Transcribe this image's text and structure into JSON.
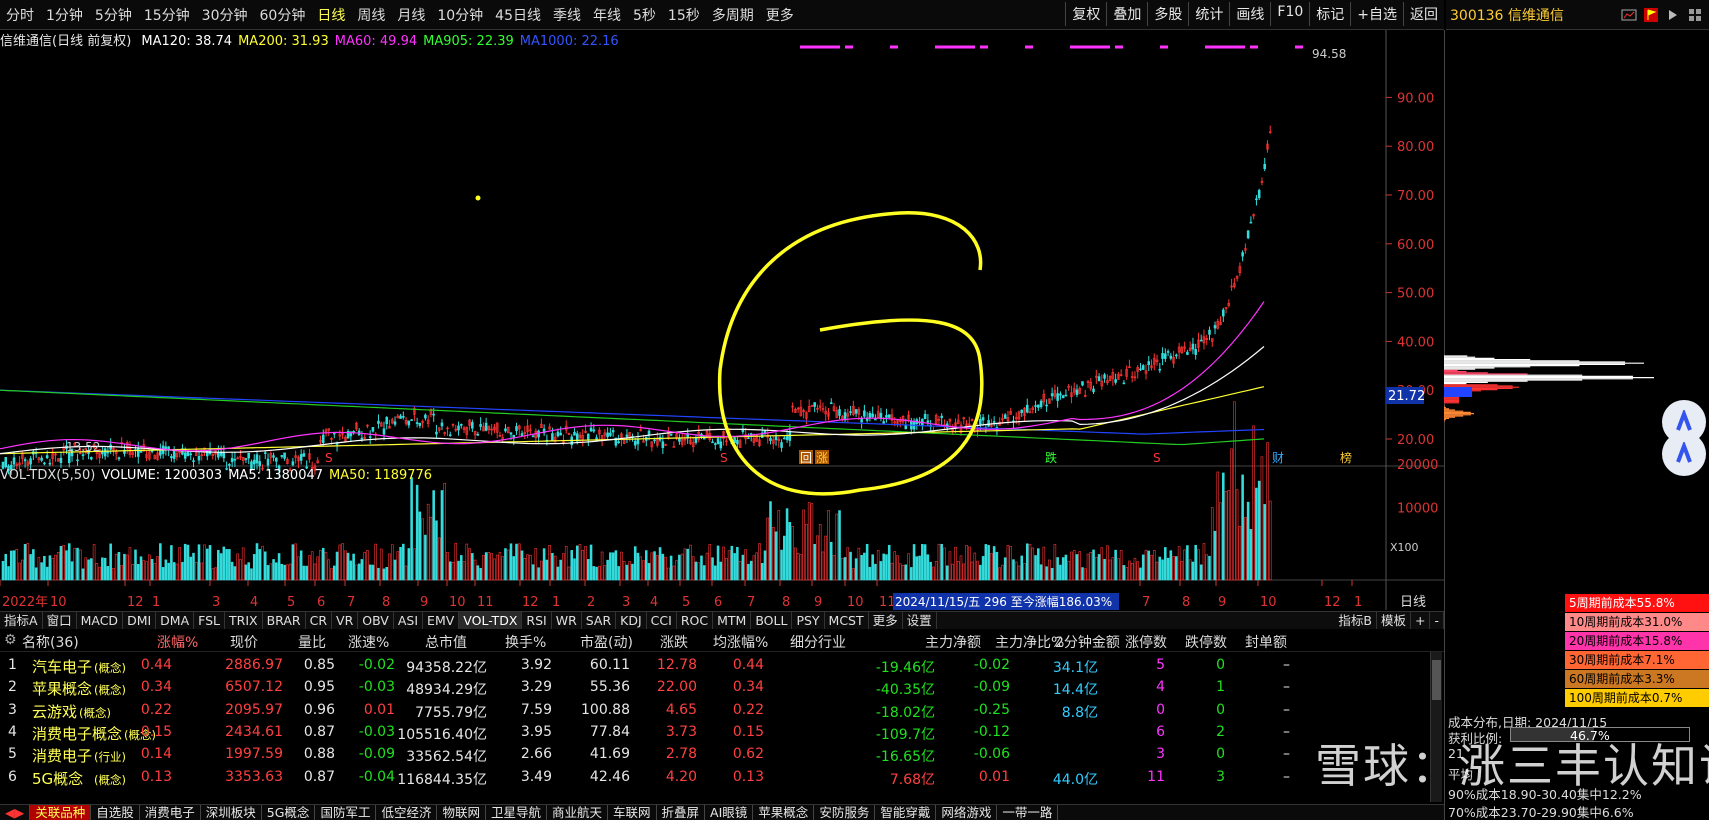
{
  "periods": [
    {
      "label": "分时",
      "active": false
    },
    {
      "label": "1分钟",
      "active": false
    },
    {
      "label": "5分钟",
      "active": false
    },
    {
      "label": "15分钟",
      "active": false
    },
    {
      "label": "30分钟",
      "active": false
    },
    {
      "label": "60分钟",
      "active": false
    },
    {
      "label": "日线",
      "active": true
    },
    {
      "label": "周线",
      "active": false
    },
    {
      "label": "月线",
      "active": false
    },
    {
      "label": "10分钟",
      "active": false
    },
    {
      "label": "45日线",
      "active": false
    },
    {
      "label": "季线",
      "active": false
    },
    {
      "label": "年线",
      "active": false
    },
    {
      "label": "5秒",
      "active": false
    },
    {
      "label": "15秒",
      "active": false
    },
    {
      "label": "多周期",
      "active": false
    },
    {
      "label": "更多",
      "active": false
    }
  ],
  "toolbar": [
    "复权",
    "叠加",
    "多股",
    "统计",
    "画线",
    "F10",
    "标记",
    "+自选",
    "返回"
  ],
  "stock": {
    "code_name": "300136 信维通信"
  },
  "ma_header": {
    "title": "信维通信(日线 前复权)",
    "items": [
      {
        "text": "MA120: 38.74",
        "color": "#ffffff"
      },
      {
        "text": "MA200: 31.93",
        "color": "#ffff33"
      },
      {
        "text": "MA60: 49.94",
        "color": "#ff33ff"
      },
      {
        "text": "MA905: 22.39",
        "color": "#33ff33"
      },
      {
        "text": "MA1000: 22.16",
        "color": "#3355ff"
      }
    ]
  },
  "chart_labels": {
    "high": "94.58",
    "low": "13.52",
    "current_price": "21.72",
    "price_ticks": [
      "90.00",
      "80.00",
      "70.00",
      "60.00",
      "50.00",
      "40.00",
      "30.00",
      "20.00"
    ],
    "vol_ticks": [
      "20000",
      "10000"
    ],
    "vol_unit": "X100",
    "date_labels": [
      "2022年",
      "10",
      "12",
      "1",
      "3",
      "4",
      "5",
      "6",
      "7",
      "8",
      "9",
      "10",
      "11",
      "12",
      "1",
      "2",
      "3",
      "4",
      "5",
      "6",
      "7",
      "8",
      "9",
      "10",
      "11",
      "7",
      "8",
      "9",
      "10",
      "12",
      "1"
    ],
    "cursor_info": "2024/11/15/五  296 至今涨幅186.03%",
    "period_label": "日线",
    "markers": [
      "S",
      "S",
      "回",
      "涨",
      "跌",
      "S",
      "财",
      "榜"
    ]
  },
  "vol_header": {
    "items": [
      {
        "text": "VOL-TDX(5,50)",
        "color": "#dddddd"
      },
      {
        "text": "VOLUME: 1200303",
        "color": "#ffffff"
      },
      {
        "text": "MA5: 1380047",
        "color": "#ffffff"
      },
      {
        "text": "MA50: 1189776",
        "color": "#ffff33"
      }
    ]
  },
  "indicator_tabs": [
    "指标A",
    "窗口",
    "MACD",
    "DMI",
    "DMA",
    "FSL",
    "TRIX",
    "BRAR",
    "CR",
    "VR",
    "OBV",
    "ASI",
    "EMV",
    "VOL-TDX",
    "RSI",
    "WR",
    "SAR",
    "KDJ",
    "CCI",
    "ROC",
    "MTM",
    "BOLL",
    "PSY",
    "MCST",
    "更多",
    "设置"
  ],
  "indicator_right": [
    "指标B",
    "模板",
    "+",
    "-"
  ],
  "table": {
    "headers": [
      "名称(36)",
      "涨幅%",
      "现价",
      "量比",
      "涨速%",
      "总市值",
      "换手%",
      "市盈(动)",
      "涨跌",
      "均涨幅%",
      "细分行业",
      "主力净额",
      "主力净比%",
      "2分钟金额",
      "涨停数",
      "跌停数",
      "封单额"
    ],
    "rows": [
      {
        "idx": "1",
        "name": "汽车电子",
        "tag": "(概念)",
        "chg": "0.44",
        "price": "2886.97",
        "vr": "0.85",
        "spd": "-0.02",
        "mcap": "94358.22亿",
        "turn": "3.92",
        "pe": "60.11",
        "diff": "12.78",
        "avg": "0.44",
        "ind": "",
        "net": "-19.46亿",
        "netp": "-0.02",
        "amt2": "34.1亿",
        "up": "5",
        "dn": "0",
        "seal": "–"
      },
      {
        "idx": "2",
        "name": "苹果概念",
        "tag": "(概念)",
        "chg": "0.34",
        "price": "6507.12",
        "vr": "0.95",
        "spd": "-0.03",
        "mcap": "48934.29亿",
        "turn": "3.29",
        "pe": "55.36",
        "diff": "22.00",
        "avg": "0.34",
        "ind": "",
        "net": "-40.35亿",
        "netp": "-0.09",
        "amt2": "14.4亿",
        "up": "4",
        "dn": "1",
        "seal": "–"
      },
      {
        "idx": "3",
        "name": "云游戏",
        "tag": "(概念)",
        "chg": "0.22",
        "price": "2095.97",
        "vr": "0.96",
        "spd": "0.01",
        "mcap": "7755.79亿",
        "turn": "7.59",
        "pe": "100.88",
        "diff": "4.65",
        "avg": "0.22",
        "ind": "",
        "net": "-18.02亿",
        "netp": "-0.25",
        "amt2": "8.8亿",
        "up": "0",
        "dn": "0",
        "seal": "–"
      },
      {
        "idx": "4",
        "name": "消费电子概念",
        "tag": "(概念)",
        "chg": "0.15",
        "price": "2434.61",
        "vr": "0.87",
        "spd": "-0.03",
        "mcap": "105516.40亿",
        "turn": "3.95",
        "pe": "77.84",
        "diff": "3.73",
        "avg": "0.15",
        "ind": "",
        "net": "-109.7亿",
        "netp": "-0.12",
        "amt2": "",
        "up": "6",
        "dn": "2",
        "seal": "–"
      },
      {
        "idx": "5",
        "name": "消费电子",
        "tag": "(行业)",
        "chg": "0.14",
        "price": "1997.59",
        "vr": "0.88",
        "spd": "-0.09",
        "mcap": "33562.54亿",
        "turn": "2.66",
        "pe": "41.69",
        "diff": "2.78",
        "avg": "0.62",
        "ind": "",
        "net": "-16.65亿",
        "netp": "-0.06",
        "amt2": "",
        "up": "3",
        "dn": "0",
        "seal": "–"
      },
      {
        "idx": "6",
        "name": "5G概念",
        "tag": "(概念)",
        "chg": "0.13",
        "price": "3353.63",
        "vr": "0.87",
        "spd": "-0.04",
        "mcap": "116844.35亿",
        "turn": "3.49",
        "pe": "42.46",
        "diff": "4.20",
        "avg": "0.13",
        "ind": "",
        "net": "7.68亿",
        "netp": "0.01",
        "amt2": "44.0亿",
        "up": "11",
        "dn": "3",
        "seal": "–"
      }
    ]
  },
  "bottom_tabs": [
    "关联品种",
    "自选股",
    "消费电子",
    "深圳板块",
    "5G概念",
    "国防军工",
    "低空经济",
    "物联网",
    "卫星导航",
    "商业航天",
    "车联网",
    "折叠屏",
    "AI眼镜",
    "苹果概念",
    "安防服务",
    "智能穿戴",
    "网络游戏",
    "一带一路"
  ],
  "cost_boxes": [
    {
      "text": "5周期前成本55.8%",
      "bg": "#ff1111",
      "fg": "#ffffff"
    },
    {
      "text": "10周期前成本31.0%",
      "bg": "#ff8888",
      "fg": "#000000"
    },
    {
      "text": "20周期前成本15.8%",
      "bg": "#ff33aa",
      "fg": "#000000"
    },
    {
      "text": "30周期前成本7.1%",
      "bg": "#ff6633",
      "fg": "#000000"
    },
    {
      "text": "60周期前成本3.3%",
      "bg": "#cc7722",
      "fg": "#000000"
    },
    {
      "text": "100周期前成本0.7%",
      "bg": "#ffcc00",
      "fg": "#000000"
    }
  ],
  "cost_info": {
    "date": "成本分布,日期: 2024/11/15",
    "profit_label": "获利比例:",
    "profit_value": "46.7%",
    "profit_fraction": 0.467,
    "row3": "21",
    "row4": "平均",
    "c90": "90%成本18.90-30.40集中12.2%",
    "c70": "70%成本23.70-29.90集中6.6%"
  },
  "watermark": "雪球：涨三丰认知说"
}
